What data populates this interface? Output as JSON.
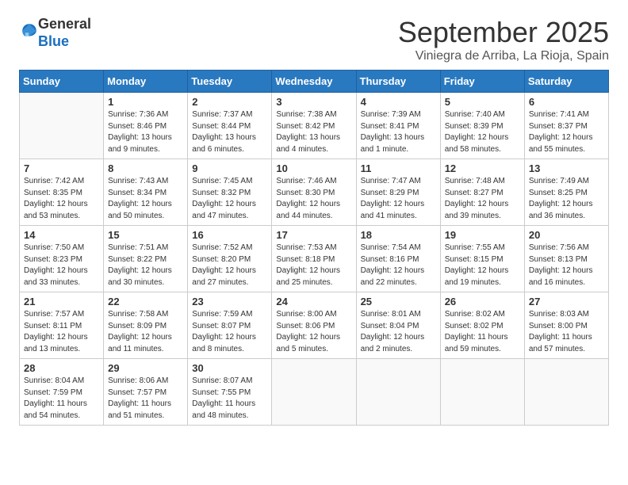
{
  "logo": {
    "general": "General",
    "blue": "Blue"
  },
  "header": {
    "month": "September 2025",
    "location": "Viniegra de Arriba, La Rioja, Spain"
  },
  "days_of_week": [
    "Sunday",
    "Monday",
    "Tuesday",
    "Wednesday",
    "Thursday",
    "Friday",
    "Saturday"
  ],
  "weeks": [
    [
      {
        "day": "",
        "content": ""
      },
      {
        "day": "1",
        "content": "Sunrise: 7:36 AM\nSunset: 8:46 PM\nDaylight: 13 hours\nand 9 minutes."
      },
      {
        "day": "2",
        "content": "Sunrise: 7:37 AM\nSunset: 8:44 PM\nDaylight: 13 hours\nand 6 minutes."
      },
      {
        "day": "3",
        "content": "Sunrise: 7:38 AM\nSunset: 8:42 PM\nDaylight: 13 hours\nand 4 minutes."
      },
      {
        "day": "4",
        "content": "Sunrise: 7:39 AM\nSunset: 8:41 PM\nDaylight: 13 hours\nand 1 minute."
      },
      {
        "day": "5",
        "content": "Sunrise: 7:40 AM\nSunset: 8:39 PM\nDaylight: 12 hours\nand 58 minutes."
      },
      {
        "day": "6",
        "content": "Sunrise: 7:41 AM\nSunset: 8:37 PM\nDaylight: 12 hours\nand 55 minutes."
      }
    ],
    [
      {
        "day": "7",
        "content": "Sunrise: 7:42 AM\nSunset: 8:35 PM\nDaylight: 12 hours\nand 53 minutes."
      },
      {
        "day": "8",
        "content": "Sunrise: 7:43 AM\nSunset: 8:34 PM\nDaylight: 12 hours\nand 50 minutes."
      },
      {
        "day": "9",
        "content": "Sunrise: 7:45 AM\nSunset: 8:32 PM\nDaylight: 12 hours\nand 47 minutes."
      },
      {
        "day": "10",
        "content": "Sunrise: 7:46 AM\nSunset: 8:30 PM\nDaylight: 12 hours\nand 44 minutes."
      },
      {
        "day": "11",
        "content": "Sunrise: 7:47 AM\nSunset: 8:29 PM\nDaylight: 12 hours\nand 41 minutes."
      },
      {
        "day": "12",
        "content": "Sunrise: 7:48 AM\nSunset: 8:27 PM\nDaylight: 12 hours\nand 39 minutes."
      },
      {
        "day": "13",
        "content": "Sunrise: 7:49 AM\nSunset: 8:25 PM\nDaylight: 12 hours\nand 36 minutes."
      }
    ],
    [
      {
        "day": "14",
        "content": "Sunrise: 7:50 AM\nSunset: 8:23 PM\nDaylight: 12 hours\nand 33 minutes."
      },
      {
        "day": "15",
        "content": "Sunrise: 7:51 AM\nSunset: 8:22 PM\nDaylight: 12 hours\nand 30 minutes."
      },
      {
        "day": "16",
        "content": "Sunrise: 7:52 AM\nSunset: 8:20 PM\nDaylight: 12 hours\nand 27 minutes."
      },
      {
        "day": "17",
        "content": "Sunrise: 7:53 AM\nSunset: 8:18 PM\nDaylight: 12 hours\nand 25 minutes."
      },
      {
        "day": "18",
        "content": "Sunrise: 7:54 AM\nSunset: 8:16 PM\nDaylight: 12 hours\nand 22 minutes."
      },
      {
        "day": "19",
        "content": "Sunrise: 7:55 AM\nSunset: 8:15 PM\nDaylight: 12 hours\nand 19 minutes."
      },
      {
        "day": "20",
        "content": "Sunrise: 7:56 AM\nSunset: 8:13 PM\nDaylight: 12 hours\nand 16 minutes."
      }
    ],
    [
      {
        "day": "21",
        "content": "Sunrise: 7:57 AM\nSunset: 8:11 PM\nDaylight: 12 hours\nand 13 minutes."
      },
      {
        "day": "22",
        "content": "Sunrise: 7:58 AM\nSunset: 8:09 PM\nDaylight: 12 hours\nand 11 minutes."
      },
      {
        "day": "23",
        "content": "Sunrise: 7:59 AM\nSunset: 8:07 PM\nDaylight: 12 hours\nand 8 minutes."
      },
      {
        "day": "24",
        "content": "Sunrise: 8:00 AM\nSunset: 8:06 PM\nDaylight: 12 hours\nand 5 minutes."
      },
      {
        "day": "25",
        "content": "Sunrise: 8:01 AM\nSunset: 8:04 PM\nDaylight: 12 hours\nand 2 minutes."
      },
      {
        "day": "26",
        "content": "Sunrise: 8:02 AM\nSunset: 8:02 PM\nDaylight: 11 hours\nand 59 minutes."
      },
      {
        "day": "27",
        "content": "Sunrise: 8:03 AM\nSunset: 8:00 PM\nDaylight: 11 hours\nand 57 minutes."
      }
    ],
    [
      {
        "day": "28",
        "content": "Sunrise: 8:04 AM\nSunset: 7:59 PM\nDaylight: 11 hours\nand 54 minutes."
      },
      {
        "day": "29",
        "content": "Sunrise: 8:06 AM\nSunset: 7:57 PM\nDaylight: 11 hours\nand 51 minutes."
      },
      {
        "day": "30",
        "content": "Sunrise: 8:07 AM\nSunset: 7:55 PM\nDaylight: 11 hours\nand 48 minutes."
      },
      {
        "day": "",
        "content": ""
      },
      {
        "day": "",
        "content": ""
      },
      {
        "day": "",
        "content": ""
      },
      {
        "day": "",
        "content": ""
      }
    ]
  ]
}
